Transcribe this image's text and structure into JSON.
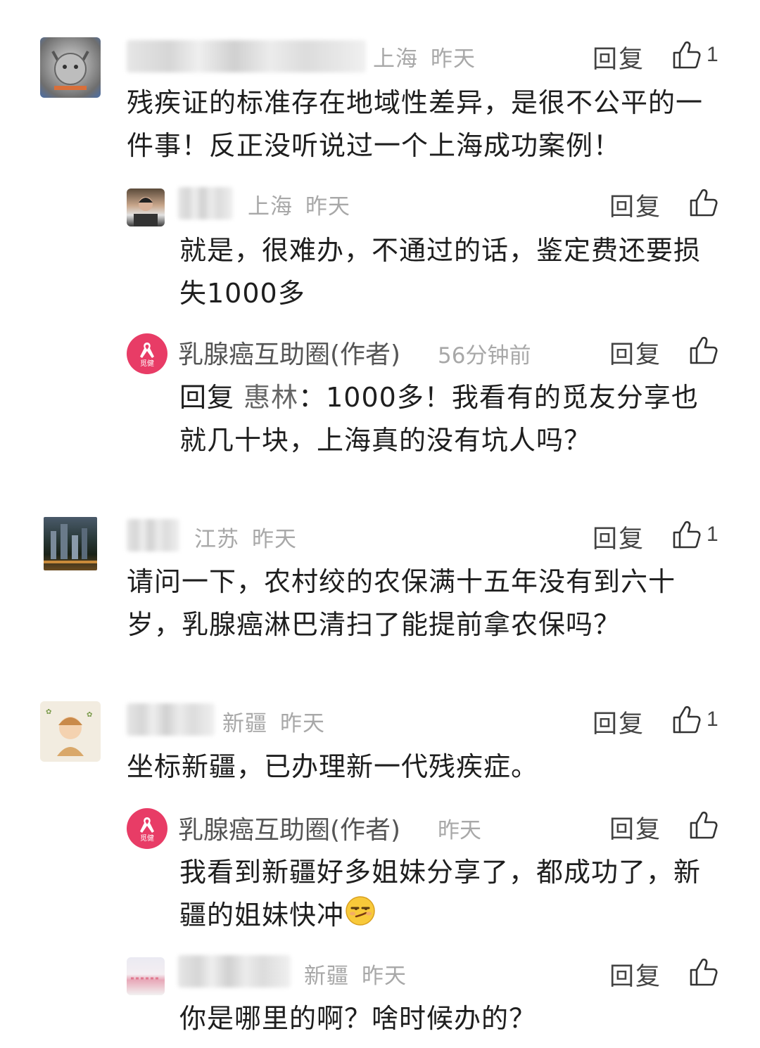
{
  "reply_label": "回复",
  "comments": [
    {
      "location": "上海",
      "time": "昨天",
      "likes": "1",
      "text": "残疾证的标准存在地域性差异，是很不公平的一件事！反正没听说过一个上海成功案例！",
      "replies": [
        {
          "location": "上海",
          "time": "昨天",
          "text": "就是，很难办，不通过的话，鉴定费还要损失1000多"
        },
        {
          "author_name": "乳腺癌互助圈(作者)",
          "time": "56分钟前",
          "reply_prefix": "回复",
          "reply_target": "惠林",
          "text": "：1000多！我看有的觅友分享也就几十块，上海真的没有坑人吗？",
          "avatar_text": "觅健"
        }
      ]
    },
    {
      "location": "江苏",
      "time": "昨天",
      "likes": "1",
      "text": "请问一下，农村绞的农保满十五年没有到六十岁，乳腺癌淋巴清扫了能提前拿农保吗？"
    },
    {
      "location": "新疆",
      "time": "昨天",
      "likes": "1",
      "text": "坐标新疆，已办理新一代残疾症。",
      "replies": [
        {
          "author_name": "乳腺癌互助圈(作者)",
          "time": "昨天",
          "text": "我看到新疆好多姐妹分享了，都成功了，新疆的姐妹快冲",
          "avatar_text": "觅健"
        },
        {
          "location": "新疆",
          "time": "昨天",
          "text": "你是哪里的啊？啥时候办的？"
        }
      ]
    }
  ],
  "colors": {
    "author_avatar": "#e83c66",
    "meta_text": "#a8a8a8"
  },
  "icons": {
    "like": "thumbs-up-icon",
    "emoji": "smirk-face-emoji",
    "ribbon": "pink-ribbon-icon"
  }
}
